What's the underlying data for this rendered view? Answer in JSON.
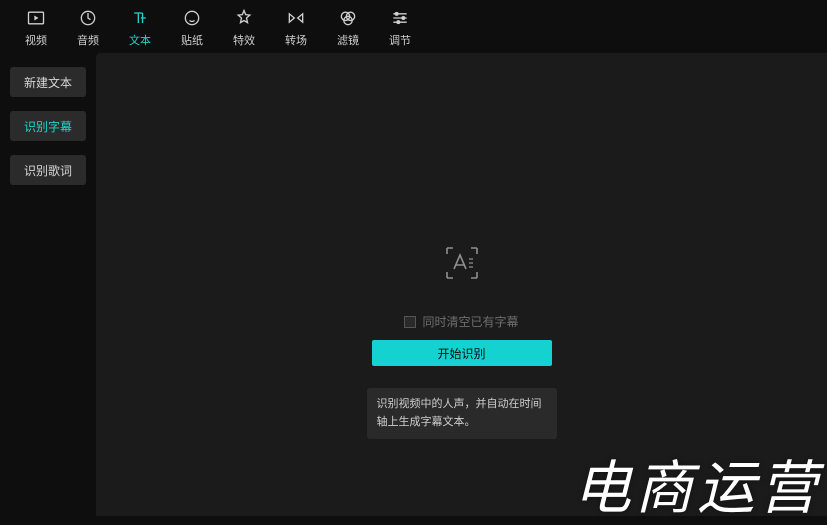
{
  "topTabs": [
    {
      "name": "video",
      "label": "视频"
    },
    {
      "name": "audio",
      "label": "音频"
    },
    {
      "name": "text",
      "label": "文本",
      "active": true
    },
    {
      "name": "sticker",
      "label": "贴纸"
    },
    {
      "name": "effects",
      "label": "特效"
    },
    {
      "name": "transition",
      "label": "转场"
    },
    {
      "name": "filter",
      "label": "滤镜"
    },
    {
      "name": "adjust",
      "label": "调节"
    }
  ],
  "sidebar": {
    "newText": "新建文本",
    "recognizeSubtitle": "识别字幕",
    "recognizeLyrics": "识别歌词"
  },
  "panel": {
    "clearExistingLabel": "同时清空已有字幕",
    "startButton": "开始识别",
    "description": "识别视频中的人声，并自动在时间轴上生成字幕文本。"
  },
  "watermark": "电商运营"
}
